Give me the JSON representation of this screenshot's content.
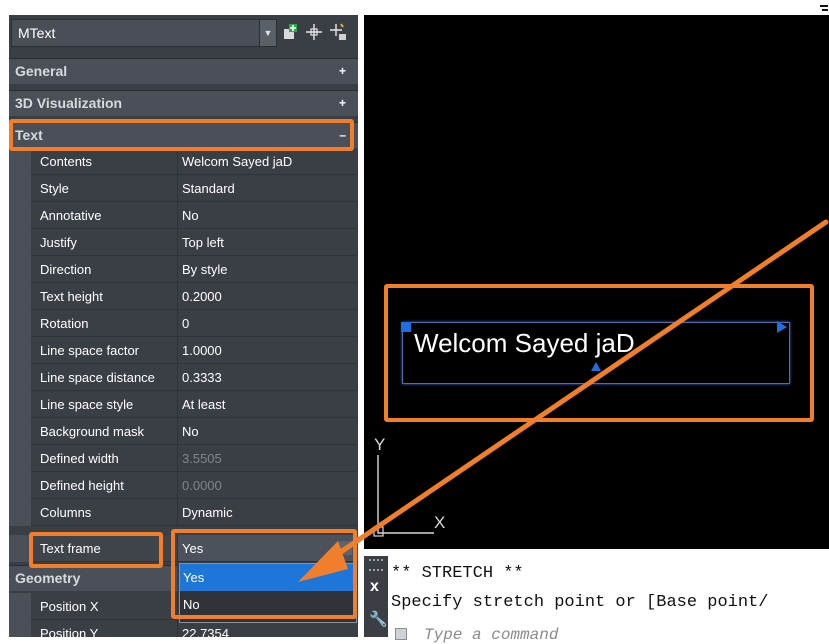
{
  "palette": {
    "object_type": "MText",
    "toolbar_icons": [
      "toggle-pickadd-icon",
      "select-objects-icon",
      "quick-select-icon"
    ],
    "categories": {
      "general": {
        "label": "General",
        "toggle": "+"
      },
      "visualization": {
        "label": "3D Visualization",
        "toggle": "+"
      },
      "text": {
        "label": "Text",
        "toggle": "–"
      },
      "geometry": {
        "label": "Geometry"
      }
    },
    "properties": [
      {
        "name": "Contents",
        "value": "Welcom Sayed jaD"
      },
      {
        "name": "Style",
        "value": "Standard"
      },
      {
        "name": "Annotative",
        "value": "No"
      },
      {
        "name": "Justify",
        "value": "Top left"
      },
      {
        "name": "Direction",
        "value": "By style"
      },
      {
        "name": "Text height",
        "value": "0.2000"
      },
      {
        "name": "Rotation",
        "value": "0"
      },
      {
        "name": "Line space factor",
        "value": "1.0000"
      },
      {
        "name": "Line space distance",
        "value": "0.3333"
      },
      {
        "name": "Line space style",
        "value": "At least"
      },
      {
        "name": "Background mask",
        "value": "No"
      },
      {
        "name": "Defined width",
        "value": "3.5505"
      },
      {
        "name": "Defined height",
        "value": "0.0000"
      },
      {
        "name": "Columns",
        "value": "Dynamic"
      }
    ],
    "text_frame": {
      "name": "Text frame",
      "value": "Yes",
      "options": [
        "Yes",
        "No"
      ],
      "selected": "Yes"
    },
    "geometry_rows": [
      {
        "name": "Position X"
      },
      {
        "name": "Position Y",
        "value": "22.7354"
      }
    ]
  },
  "canvas": {
    "mtext": "Welcom Sayed jaD",
    "ucs_x": "X",
    "ucs_y": "Y"
  },
  "command_line": {
    "close_glyph": "x",
    "history": [
      "** STRETCH **",
      "Specify stretch point or [Base point/"
    ],
    "prompt_placeholder": "Type a command"
  },
  "colors": {
    "highlight": "#f07e2a",
    "selection": "#1e76d9",
    "grip": "#1e6fe0"
  }
}
